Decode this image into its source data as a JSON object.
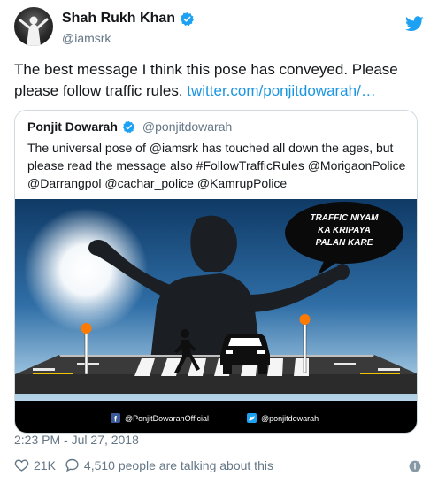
{
  "author": {
    "name": "Shah Rukh Khan",
    "handle": "@iamsrk",
    "verified": true
  },
  "tweet": {
    "text": "The best message I think this pose has conveyed. Please please follow traffic rules. ",
    "link": "twitter.com/ponjitdowarah/…"
  },
  "quote": {
    "name": "Ponjit Dowarah",
    "handle": "@ponjitdowarah",
    "verified": true,
    "text": "The universal pose of @iamsrk has touched all down the ages, but please read the message also #FollowTrafficRules @MorigaonPolice @Darrangpol @cachar_police @KamrupPolice",
    "image": {
      "speech_lines": [
        "TRAFFIC NIYAM",
        "KA KRIPAYA",
        "PALAN KARE"
      ],
      "facebook_credit": "@PonjitDowarahOfficial",
      "twitter_credit": "@ponjitdowarah"
    }
  },
  "timestamp": "2:23 PM - Jul 27, 2018",
  "actions": {
    "likes": "21K",
    "talking": "4,510 people are talking about this"
  },
  "colors": {
    "link": "#1b95e0",
    "verified": "#1da1f2",
    "muted": "#657786"
  },
  "icons": [
    "verified-badge-icon",
    "twitter-bird-icon",
    "heart-icon",
    "comment-bubble-icon",
    "info-icon",
    "facebook-icon"
  ]
}
